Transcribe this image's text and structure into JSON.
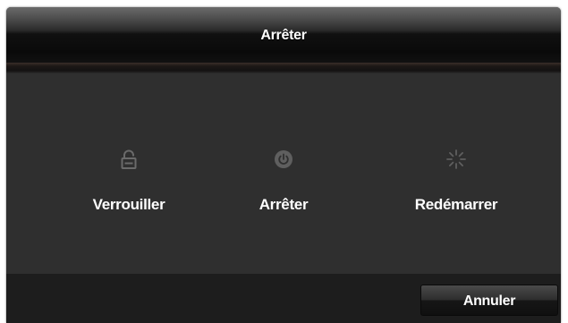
{
  "dialog": {
    "title": "Arrêter"
  },
  "options": [
    {
      "label": "Verrouiller",
      "icon": "lock-icon"
    },
    {
      "label": "Arrêter",
      "icon": "power-icon"
    },
    {
      "label": "Redémarrer",
      "icon": "restart-spinner-icon"
    }
  ],
  "footer": {
    "cancel_label": "Annuler"
  },
  "colors": {
    "dialog_background": "#2f2f2f",
    "footer_background": "#1d1d1d",
    "icon_color": "#5f5f5f",
    "text_color": "#ffffff"
  }
}
